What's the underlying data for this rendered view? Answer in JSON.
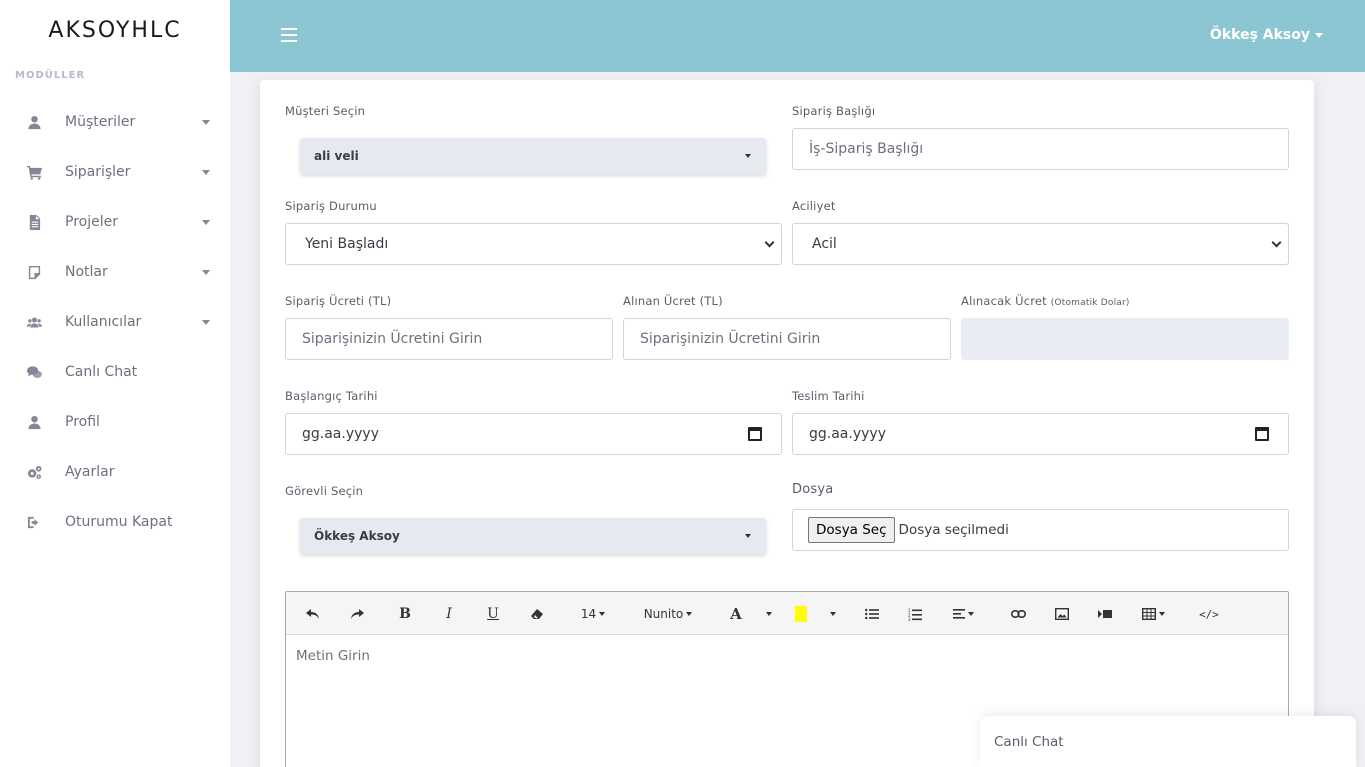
{
  "sidebar": {
    "brand": "AKSOYHLC",
    "heading": "MODÜLLER",
    "items": [
      {
        "label": "Müşteriler",
        "icon": "user-icon",
        "dropdown": true
      },
      {
        "label": "Siparişler",
        "icon": "cart-icon",
        "dropdown": true
      },
      {
        "label": "Projeler",
        "icon": "file-icon",
        "dropdown": true
      },
      {
        "label": "Notlar",
        "icon": "note-icon",
        "dropdown": true
      },
      {
        "label": "Kullanıcılar",
        "icon": "users-icon",
        "dropdown": true
      },
      {
        "label": "Canlı Chat",
        "icon": "chat-icon",
        "dropdown": false
      },
      {
        "label": "Profil",
        "icon": "profile-icon",
        "dropdown": false
      },
      {
        "label": "Ayarlar",
        "icon": "gears-icon",
        "dropdown": false
      },
      {
        "label": "Oturumu Kapat",
        "icon": "sign-out-icon",
        "dropdown": false
      }
    ]
  },
  "topbar": {
    "user_name": "Ökkeş Aksoy"
  },
  "form": {
    "customer": {
      "label": "Müşteri Seçin",
      "value": "ali veli"
    },
    "order_title": {
      "label": "Sipariş Başlığı",
      "placeholder": "İş-Sipariş Başlığı"
    },
    "order_status": {
      "label": "Sipariş Durumu",
      "value": "Yeni Başladı"
    },
    "urgency": {
      "label": "Aciliyet",
      "value": "Acil"
    },
    "order_fee": {
      "label": "Sipariş Ücreti (TL)",
      "placeholder": "Siparişinizin Ücretini Girin"
    },
    "received_fee": {
      "label": "Alınan Ücret (TL)",
      "placeholder": "Siparişinizin Ücretini Girin"
    },
    "due_fee": {
      "label": "Alınacak Ücret",
      "label_note": "(Otomatik Dolar)",
      "value": ""
    },
    "start_date": {
      "label": "Başlangıç Tarihi",
      "value": "gg.aa.yyyy"
    },
    "delivery_date": {
      "label": "Teslim Tarihi",
      "value": "gg.aa.yyyy"
    },
    "assignee": {
      "label": "Görevli Seçin",
      "value": "Ökkeş Aksoy"
    },
    "file": {
      "label": "Dosya",
      "button": "Dosya Seç",
      "status": "Dosya seçilmedi"
    }
  },
  "editor": {
    "font_size": "14",
    "font_name": "Nunito",
    "highlight_color": "#ffff00",
    "placeholder": "Metin Girin",
    "tools": [
      "undo-icon",
      "redo-icon",
      "bold-icon",
      "italic-icon",
      "underline-icon",
      "eraser-icon",
      "font-size-dropdown",
      "font-name-dropdown",
      "font-color-icon",
      "highlight-color-icon",
      "unordered-list-icon",
      "ordered-list-icon",
      "align-icon",
      "link-icon",
      "image-icon",
      "video-icon",
      "table-icon",
      "code-view-icon"
    ]
  },
  "chat_widget": {
    "label": "Canlı Chat"
  },
  "colors": {
    "topbar": "#8dc6d3",
    "sidebar": "#ffffff",
    "background": "#f0f1f4"
  }
}
